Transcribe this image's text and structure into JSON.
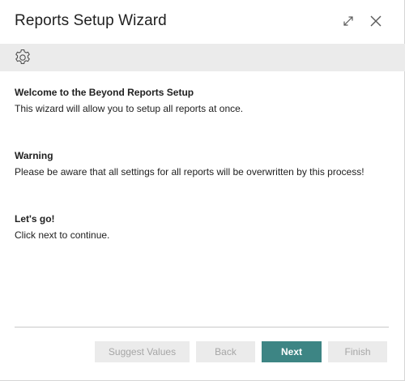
{
  "window": {
    "title": "Reports Setup Wizard",
    "expand_icon": "expand-diagonal-icon",
    "close_icon": "close-icon"
  },
  "toolbar": {
    "icon": "gear-icon"
  },
  "sections": [
    {
      "heading": "Welcome to the Beyond Reports Setup",
      "text": "This wizard will allow you to setup all reports at once."
    },
    {
      "heading": "Warning",
      "text": "Please be aware that all settings for all reports will be overwritten by this process!"
    },
    {
      "heading": "Let's go!",
      "text": "Click next to continue."
    }
  ],
  "footer": {
    "suggest_label": "Suggest Values",
    "back_label": "Back",
    "next_label": "Next",
    "finish_label": "Finish"
  },
  "colors": {
    "primary": "#3d8584",
    "toolbar_bg": "#ebebeb",
    "disabled_bg": "#ebebeb",
    "disabled_text": "#a6a6a6"
  }
}
